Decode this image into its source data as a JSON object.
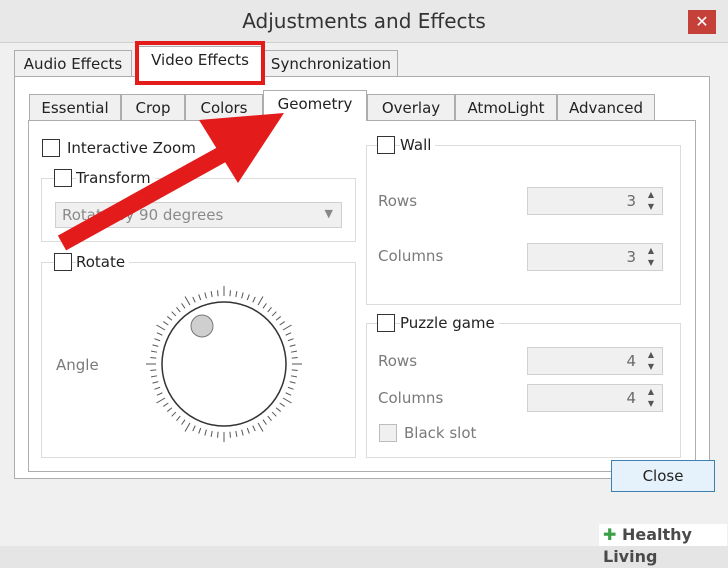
{
  "window": {
    "title": "Adjustments and Effects",
    "close_glyph": "✕"
  },
  "main_tabs": [
    "Audio Effects",
    "Video Effects",
    "Synchronization"
  ],
  "video_tabs": [
    "Essential",
    "Crop",
    "Colors",
    "Geometry",
    "Overlay",
    "AtmoLight",
    "Advanced"
  ],
  "geometry": {
    "interactive_zoom": "Interactive Zoom",
    "transform": "Transform",
    "transform_select": "Rotate by 90 degrees",
    "rotate": "Rotate",
    "angle_label": "Angle",
    "wall": {
      "label": "Wall",
      "rows_label": "Rows",
      "rows_value": "3",
      "columns_label": "Columns",
      "columns_value": "3"
    },
    "puzzle": {
      "label": "Puzzle game",
      "rows_label": "Rows",
      "rows_value": "4",
      "columns_label": "Columns",
      "columns_value": "4",
      "black_slot": "Black slot"
    }
  },
  "close_button": "Close",
  "watermark": {
    "mark": "✚",
    "text": "Healthy Living"
  },
  "colors": {
    "annotation": "#e31b1b",
    "accent": "#3c7fb1"
  }
}
